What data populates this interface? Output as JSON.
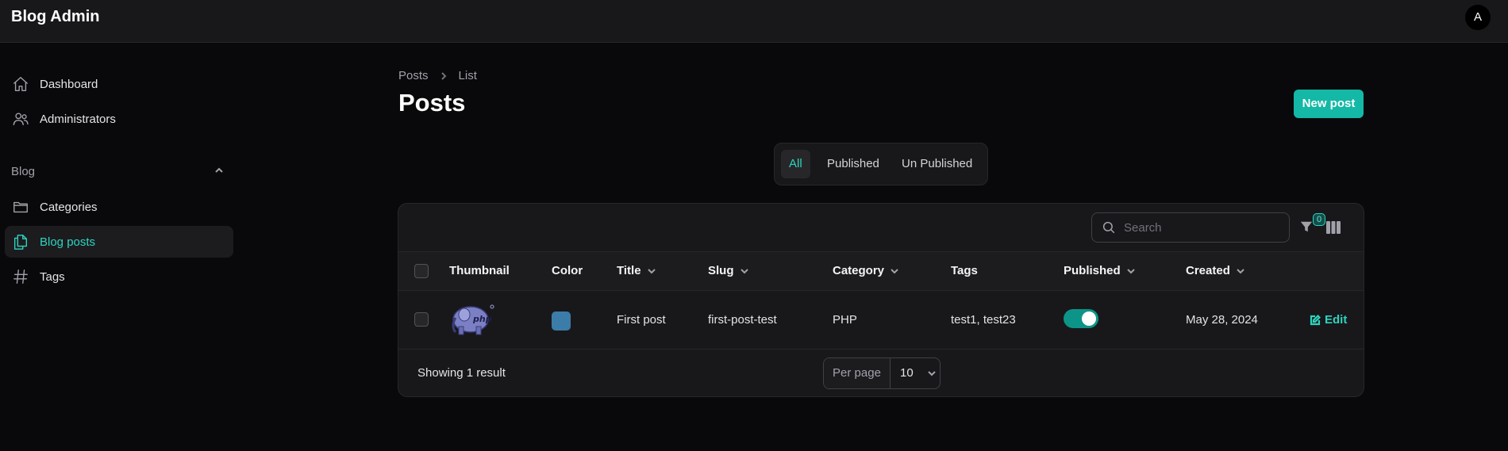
{
  "app": {
    "title": "Blog Admin",
    "avatar_initial": "A"
  },
  "sidebar": {
    "items": [
      {
        "label": "Dashboard",
        "icon": "home-icon"
      },
      {
        "label": "Administrators",
        "icon": "users-icon"
      }
    ],
    "group": {
      "label": "Blog",
      "expanded": true,
      "items": [
        {
          "label": "Categories",
          "icon": "folder-icon"
        },
        {
          "label": "Blog posts",
          "icon": "documents-icon",
          "active": true
        },
        {
          "label": "Tags",
          "icon": "hashtag-icon"
        }
      ]
    }
  },
  "breadcrumb": [
    "Posts",
    "List"
  ],
  "page": {
    "title": "Posts",
    "new_button": "New post"
  },
  "tabs": [
    {
      "label": "All",
      "active": true
    },
    {
      "label": "Published"
    },
    {
      "label": "Un Published"
    }
  ],
  "table": {
    "search_placeholder": "Search",
    "filter_count": "0",
    "columns": [
      "Thumbnail",
      "Color",
      "Title",
      "Slug",
      "Category",
      "Tags",
      "Published",
      "Created"
    ],
    "rows": [
      {
        "thumbnail": "php-elephant",
        "color": "#3b7ca8",
        "title": "First post",
        "slug": "first-post-test",
        "category": "PHP",
        "tags": "test1, test23",
        "published": true,
        "created": "May 28, 2024",
        "action": "Edit"
      }
    ],
    "footer": {
      "showing": "Showing 1 result",
      "per_page_label": "Per page",
      "per_page_value": "10"
    }
  },
  "colors": {
    "accent": "#14b8a6",
    "background": "#09090b",
    "panel": "#18181b"
  }
}
